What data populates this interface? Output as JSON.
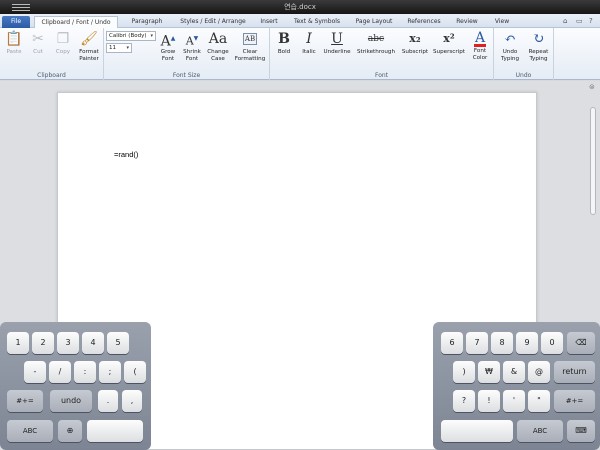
{
  "window": {
    "title": "연습.docx"
  },
  "tabs": [
    {
      "label": "File"
    },
    {
      "label": "Clipboard / Font / Undo"
    },
    {
      "label": "Paragraph"
    },
    {
      "label": "Styles / Edit / Arrange"
    },
    {
      "label": "Insert"
    },
    {
      "label": "Text & Symbols"
    },
    {
      "label": "Page Layout"
    },
    {
      "label": "References"
    },
    {
      "label": "Review"
    },
    {
      "label": "View"
    }
  ],
  "clipboard": {
    "label": "Clipboard",
    "paste": "Paste",
    "cut": "Cut",
    "copy": "Copy",
    "format_painter": "Format Painter"
  },
  "fontsize_group": {
    "label": "Font Size",
    "font_name": "Calibri (Body)",
    "font_size": "11",
    "grow_font": "Grow Font",
    "shrink_font": "Shrink Font",
    "change_case": "Change Case",
    "clear_formatting": "Clear Formatting",
    "grow_glyph": "A",
    "shrink_glyph": "A",
    "case_glyph": "Aa",
    "clear_glyph": "AB"
  },
  "font_group": {
    "label": "Font",
    "bold": "Bold",
    "italic": "Italic",
    "underline": "Underline",
    "strikethrough": "Strikethrough",
    "subscript": "Subscript",
    "superscript": "Superscript",
    "font_color": "Font Color",
    "bold_glyph": "B",
    "italic_glyph": "I",
    "underline_glyph": "U",
    "strike_glyph": "abc",
    "sub_glyph": "x₂",
    "sup_glyph": "x²",
    "color_glyph": "A"
  },
  "undo_group": {
    "label": "Undo",
    "undo": "Undo Typing",
    "redo": "Repeat Typing"
  },
  "document": {
    "text": "=rand()"
  },
  "keyboard": {
    "left": {
      "row1": [
        "1",
        "2",
        "3",
        "4",
        "5"
      ],
      "row2": [
        "-",
        "/",
        ":",
        ";",
        "("
      ],
      "row3": [
        "#+=",
        "undo",
        ".",
        ","
      ],
      "row4": [
        "ABC"
      ]
    },
    "right": {
      "row1": [
        "6",
        "7",
        "8",
        "9",
        "0"
      ],
      "row2": [
        ")",
        "₩",
        "&",
        "@",
        "return"
      ],
      "row3": [
        "?",
        "!",
        "'",
        "\"",
        "#+="
      ],
      "row4": [
        "ABC"
      ]
    }
  },
  "colors": {
    "accent": "#2c5aa5",
    "font_color_bar": "#e02020"
  }
}
